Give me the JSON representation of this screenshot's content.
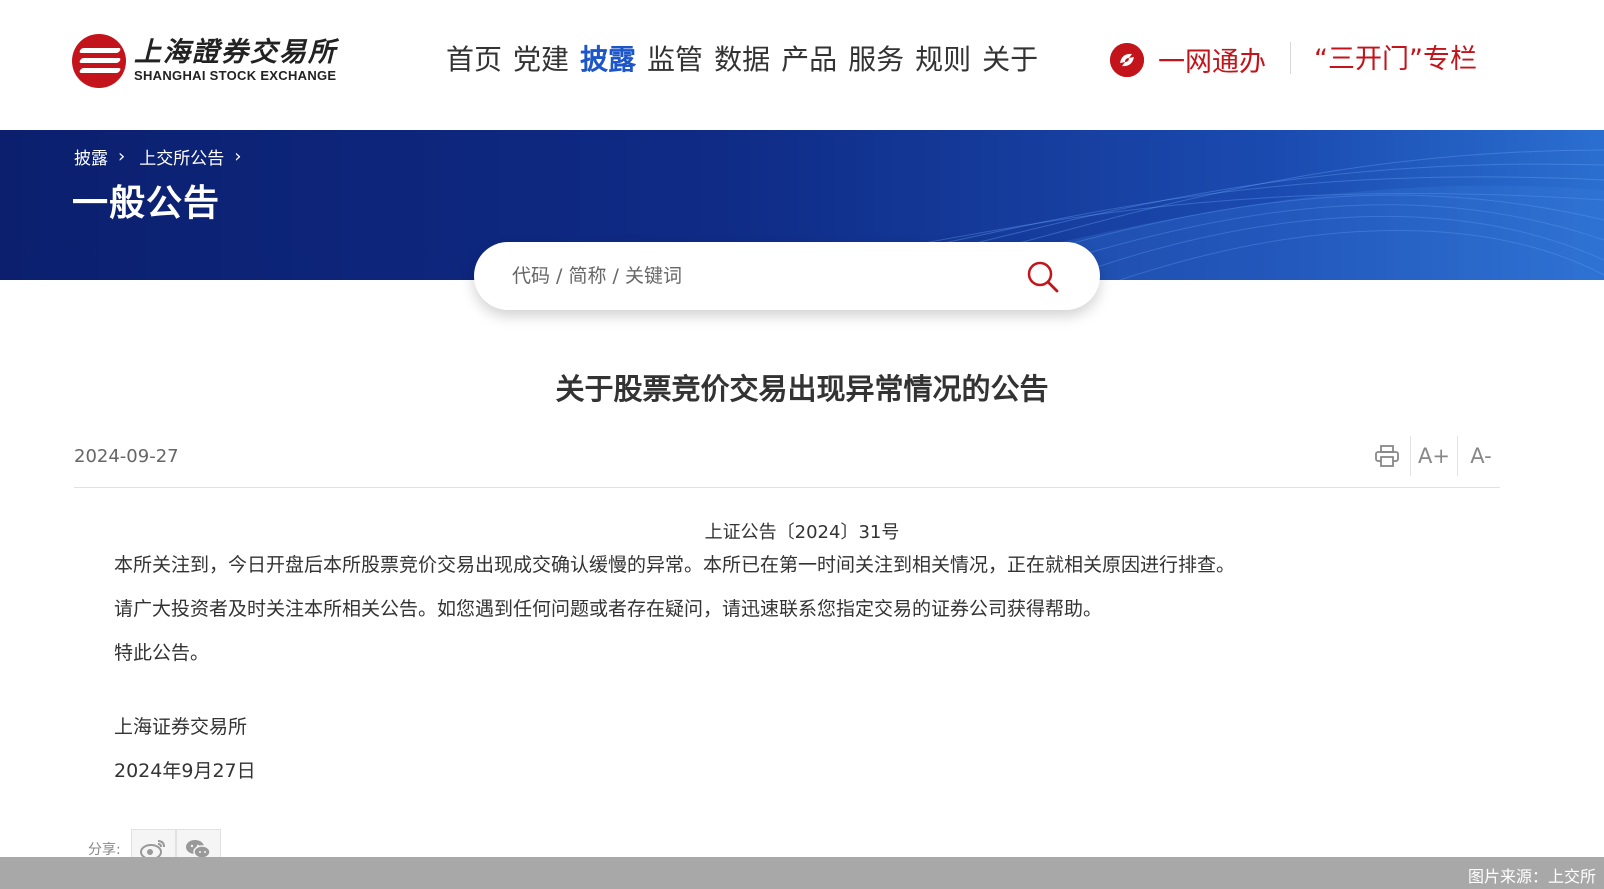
{
  "header": {
    "logo_cn": "上海證券交易所",
    "logo_en": "SHANGHAI STOCK EXCHANGE",
    "nav": [
      "首页",
      "党建",
      "披露",
      "监管",
      "数据",
      "产品",
      "服务",
      "规则",
      "关于"
    ],
    "active_nav": "披露",
    "ywtb_label": "一网通办",
    "smk_label": "“三开门”专栏"
  },
  "banner": {
    "breadcrumb": [
      "披露",
      "上交所公告"
    ],
    "title": "一般公告"
  },
  "search": {
    "placeholder": "代码 / 简称 / 关键词"
  },
  "article": {
    "title": "关于股票竞价交易出现异常情况的公告",
    "date": "2024-09-27",
    "tools": {
      "print_icon": "printer-icon",
      "font_increase": "A+",
      "font_decrease": "A-"
    },
    "doc_no": "上证公告〔2024〕31号",
    "paragraphs": [
      "本所关注到，今日开盘后本所股票竞价交易出现成交确认缓慢的异常。本所已在第一时间关注到相关情况，正在就相关原因进行排查。",
      "请广大投资者及时关注本所相关公告。如您遇到任何问题或者存在疑问，请迅速联系您指定交易的证券公司获得帮助。",
      "特此公告。"
    ],
    "signature": "上海证券交易所",
    "sign_date": "2024年9月27日"
  },
  "share": {
    "label": "分享:",
    "buttons": [
      "weibo-icon",
      "wechat-icon"
    ]
  },
  "footer": {
    "source": "图片来源：上交所"
  },
  "colors": {
    "brand_red": "#c3141b",
    "nav_active_blue": "#1d56c8",
    "banner_dark": "#0b1f6e"
  }
}
